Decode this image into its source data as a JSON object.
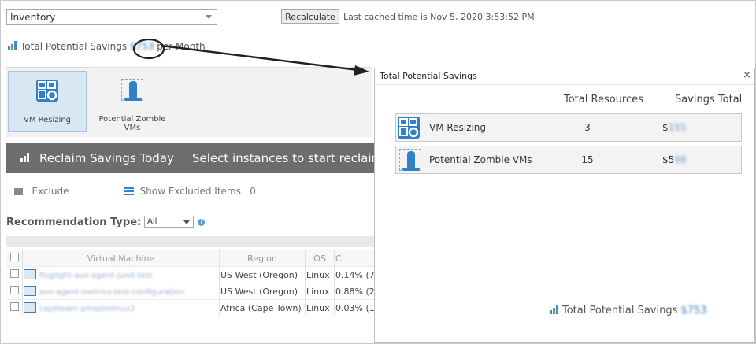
{
  "toolbar": {
    "view_select_value": "Inventory",
    "recalculate_label": "Recalculate",
    "cached_time_text": "Last cached time is Nov 5, 2020 3:53:52 PM."
  },
  "summary": {
    "prefix": "Total Potential Savings ",
    "amount": "$753",
    "suffix": " per Month"
  },
  "tiles": [
    {
      "label": "VM Resizing",
      "icon": "vm-resizing-icon"
    },
    {
      "label": "Potential Zombie VMs",
      "icon": "zombie-vm-icon"
    }
  ],
  "reclaim_bar": {
    "title": "Reclaim Savings Today",
    "subtitle": "Select instances to start reclaiming"
  },
  "actions": {
    "exclude_label": "Exclude",
    "show_excluded_label": "Show Excluded Items",
    "excluded_count": "0"
  },
  "filter": {
    "label": "Recommendation Type:",
    "value": "All"
  },
  "table": {
    "headers": [
      "Virtual Machine",
      "Region",
      "OS",
      "C"
    ],
    "rows": [
      {
        "vm": "fluglight-avo-agent-junit-test",
        "region": "US West (Oregon)",
        "os": "Linux",
        "c": "0.14% (7"
      },
      {
        "vm": "avo-agent-metrics-test-configuration",
        "region": "US West (Oregon)",
        "os": "Linux",
        "c": "0.88% (2"
      },
      {
        "vm": "capetown-amazonlinux2",
        "region": "Africa (Cape Town)",
        "os": "Linux",
        "c": "0.03% (1"
      }
    ]
  },
  "popup": {
    "title": "Total Potential Savings",
    "close_glyph": "×",
    "col_resources": "Total Resources",
    "col_savings": "Savings Total",
    "rows": [
      {
        "name": "VM Resizing",
        "resources": "3",
        "savings_prefix": "$",
        "savings_value": "155"
      },
      {
        "name": "Potential Zombie VMs",
        "resources": "15",
        "savings_prefix": "$5",
        "savings_value": "98"
      }
    ],
    "total_prefix": "Total Potential Savings ",
    "total_amount": "$753"
  },
  "colors": {
    "accent_blue": "#2f82c9",
    "dark_bar": "#6d6d6d",
    "link_blue": "#3a79c0"
  }
}
